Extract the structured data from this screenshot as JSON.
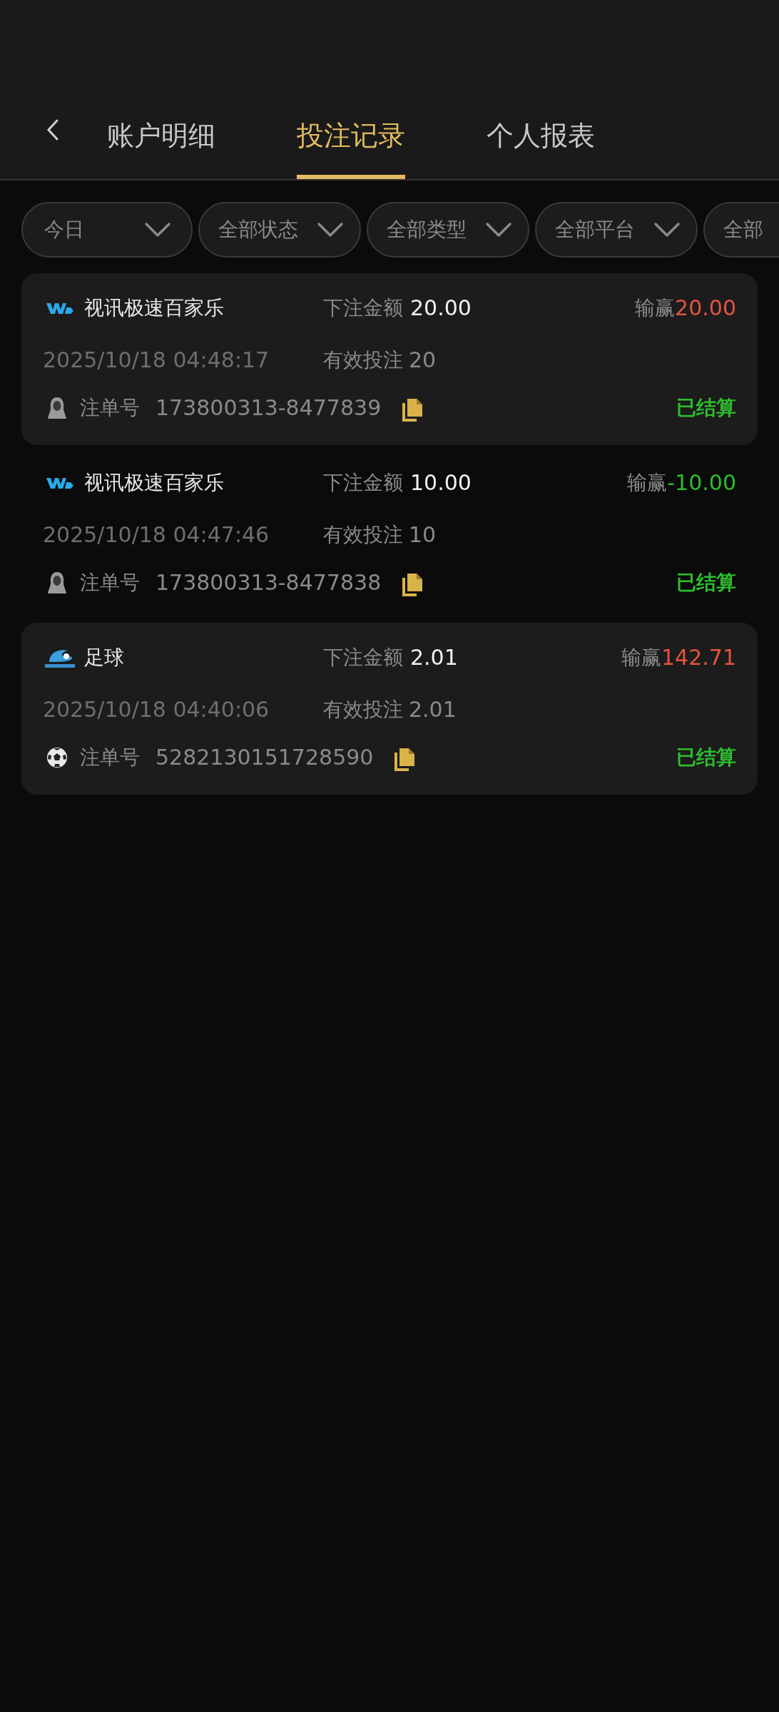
{
  "tabs": [
    {
      "label": "账户明细",
      "selected": false
    },
    {
      "label": "投注记录",
      "selected": true
    },
    {
      "label": "个人报表",
      "selected": false
    }
  ],
  "filters": [
    {
      "label": "今日"
    },
    {
      "label": "全部状态"
    },
    {
      "label": "全部类型"
    },
    {
      "label": "全部平台"
    },
    {
      "label": "全部"
    }
  ],
  "records": [
    {
      "kind": "live",
      "shaded": true,
      "game": "视讯极速百家乐",
      "amount_label": "下注金额",
      "amount": "20.00",
      "winloss_label": "输赢",
      "winloss": "20.00",
      "color": "#e5533f",
      "time": "2025/10/18 04:48:17",
      "valid_label": "有效投注",
      "valid": "20",
      "order_label": "注单号",
      "order": "173800313-8477839",
      "status": "已结算"
    },
    {
      "kind": "live",
      "shaded": false,
      "game": "视讯极速百家乐",
      "amount_label": "下注金额",
      "amount": "10.00",
      "winloss_label": "输赢",
      "winloss": "-10.00",
      "color": "#2ebd2e",
      "time": "2025/10/18 04:47:46",
      "valid_label": "有效投注",
      "valid": "10",
      "order_label": "注单号",
      "order": "173800313-8477838",
      "status": "已结算"
    },
    {
      "kind": "sports",
      "shaded": true,
      "game": "足球",
      "amount_label": "下注金额",
      "amount": "2.01",
      "winloss_label": "输赢",
      "winloss": "142.71",
      "color": "#e5533f",
      "time": "2025/10/18 04:40:06",
      "valid_label": "有效投注",
      "valid": "2.01",
      "order_label": "注单号",
      "order": "5282130151728590",
      "status": "已结算"
    }
  ]
}
